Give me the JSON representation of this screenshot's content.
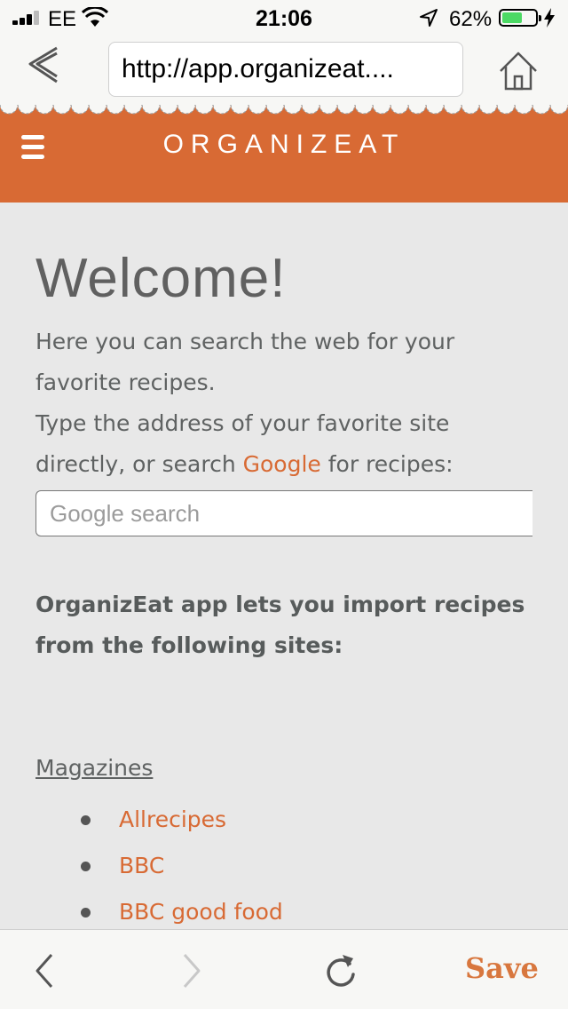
{
  "status": {
    "carrier": "EE",
    "time": "21:06",
    "battery_pct": "62%",
    "battery_level": 0.62
  },
  "browser": {
    "url": "http://app.organizeat...."
  },
  "header": {
    "brand": "ORGANIZEAT"
  },
  "main": {
    "welcome": "Welcome!",
    "intro_1": "Here you can search the web for your favorite recipes.",
    "intro_2": "Type the address of your favorite site directly, or search ",
    "google_link": "Google",
    "intro_3": " for recipes:",
    "search_placeholder": "Google search",
    "import_text": "OrganizEat app lets you import recipes from the following sites:",
    "category": "Magazines",
    "sites": [
      "Allrecipes",
      "BBC",
      "BBC good food"
    ]
  },
  "toolbar": {
    "save_label": "Save"
  },
  "colors": {
    "brand_orange": "#d86a34",
    "background": "#e8e8e8"
  }
}
